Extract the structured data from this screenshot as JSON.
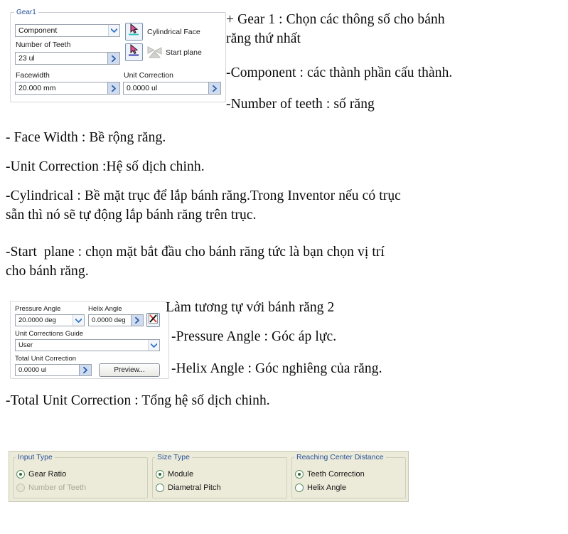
{
  "gear1_panel": {
    "group_label": "Gear1",
    "component": {
      "label": "Component",
      "value": "Component",
      "icon": "chevron-down-icon"
    },
    "number_of_teeth": {
      "label": "Number of Teeth",
      "value": "23 ul",
      "icon": "chevron-right-icon"
    },
    "facewidth": {
      "label": "Facewidth",
      "value": "20.000 mm",
      "icon": "chevron-right-icon"
    },
    "unit_correction": {
      "label": "Unit Correction",
      "value": "0.0000 ul",
      "icon": "chevron-right-icon"
    },
    "cylindrical_face": {
      "label": "Cylindrical Face",
      "icon": "select-cursor-face-icon"
    },
    "start_plane": {
      "label": "Start plane",
      "select_icon": "select-cursor-plane-icon",
      "plane_icon": "plane-icon"
    }
  },
  "gear2_panel": {
    "pressure_angle": {
      "label": "Pressure Angle",
      "value": "20.0000 deg",
      "icon": "chevron-down-icon"
    },
    "helix_angle": {
      "label": "Helix Angle",
      "value": "0.0000 deg",
      "icon": "chevron-right-icon",
      "toggle_icon": "helix-direction-icon"
    },
    "unit_corrections_guide": {
      "label": "Unit Corrections Guide",
      "value": "User",
      "icon": "chevron-down-icon"
    },
    "total_unit_correction": {
      "label": "Total Unit Correction",
      "value": "0.0000 ul",
      "icon": "chevron-right-icon"
    },
    "preview_button": {
      "label": "Preview..."
    }
  },
  "bottom_panel": {
    "groups": [
      {
        "title": "Input Type",
        "options": [
          {
            "label": "Gear Ratio",
            "checked": true,
            "disabled": false
          },
          {
            "label": "Number of Teeth",
            "checked": false,
            "disabled": true
          }
        ]
      },
      {
        "title": "Size Type",
        "options": [
          {
            "label": "Module",
            "checked": true,
            "disabled": false
          },
          {
            "label": "Diametral Pitch",
            "checked": false,
            "disabled": false
          }
        ]
      },
      {
        "title": "Reaching Center Distance",
        "options": [
          {
            "label": "Teeth Correction",
            "checked": true,
            "disabled": false
          },
          {
            "label": "Helix Angle",
            "checked": false,
            "disabled": false
          }
        ]
      }
    ]
  },
  "annotations": {
    "gear1_heading": "+ Gear 1 : Chọn các thông số cho bánh\nrăng thứ nhất",
    "component": "-Component : các thành phần cấu thành.",
    "number_of_teeth": "-Number of teeth : số răng",
    "face_width": "- Face Width : Bề rộng răng.",
    "unit_correction": "-Unit Correction :Hệ số dịch chinh.",
    "cylindrical": "-Cylindrical : Bề mặt trục để lắp bánh răng.Trong Inventor nếu có trục\nsẵn thì nó sẽ tự động lắp bánh răng trên trục.",
    "start_plane": "-Start  plane : chọn mặt bắt đầu cho bánh răng tức là bạn chọn vị trí\ncho bánh răng.",
    "gear2_heading": "Làm tương tự với bánh răng 2",
    "pressure_angle": "-Pressure Angle : Góc áp lực.",
    "helix_angle": "-Helix Angle : Góc nghiêng của răng.",
    "total_unit_correction": "-Total Unit Correction : Tổng hệ số dịch chinh."
  },
  "colors": {
    "group_label_blue": "#27509b",
    "panel_tan": "#ecebd9",
    "radio_green": "#2f6b35",
    "spin_blue": "#cfdcef",
    "text_black": "#0a0a0a"
  }
}
